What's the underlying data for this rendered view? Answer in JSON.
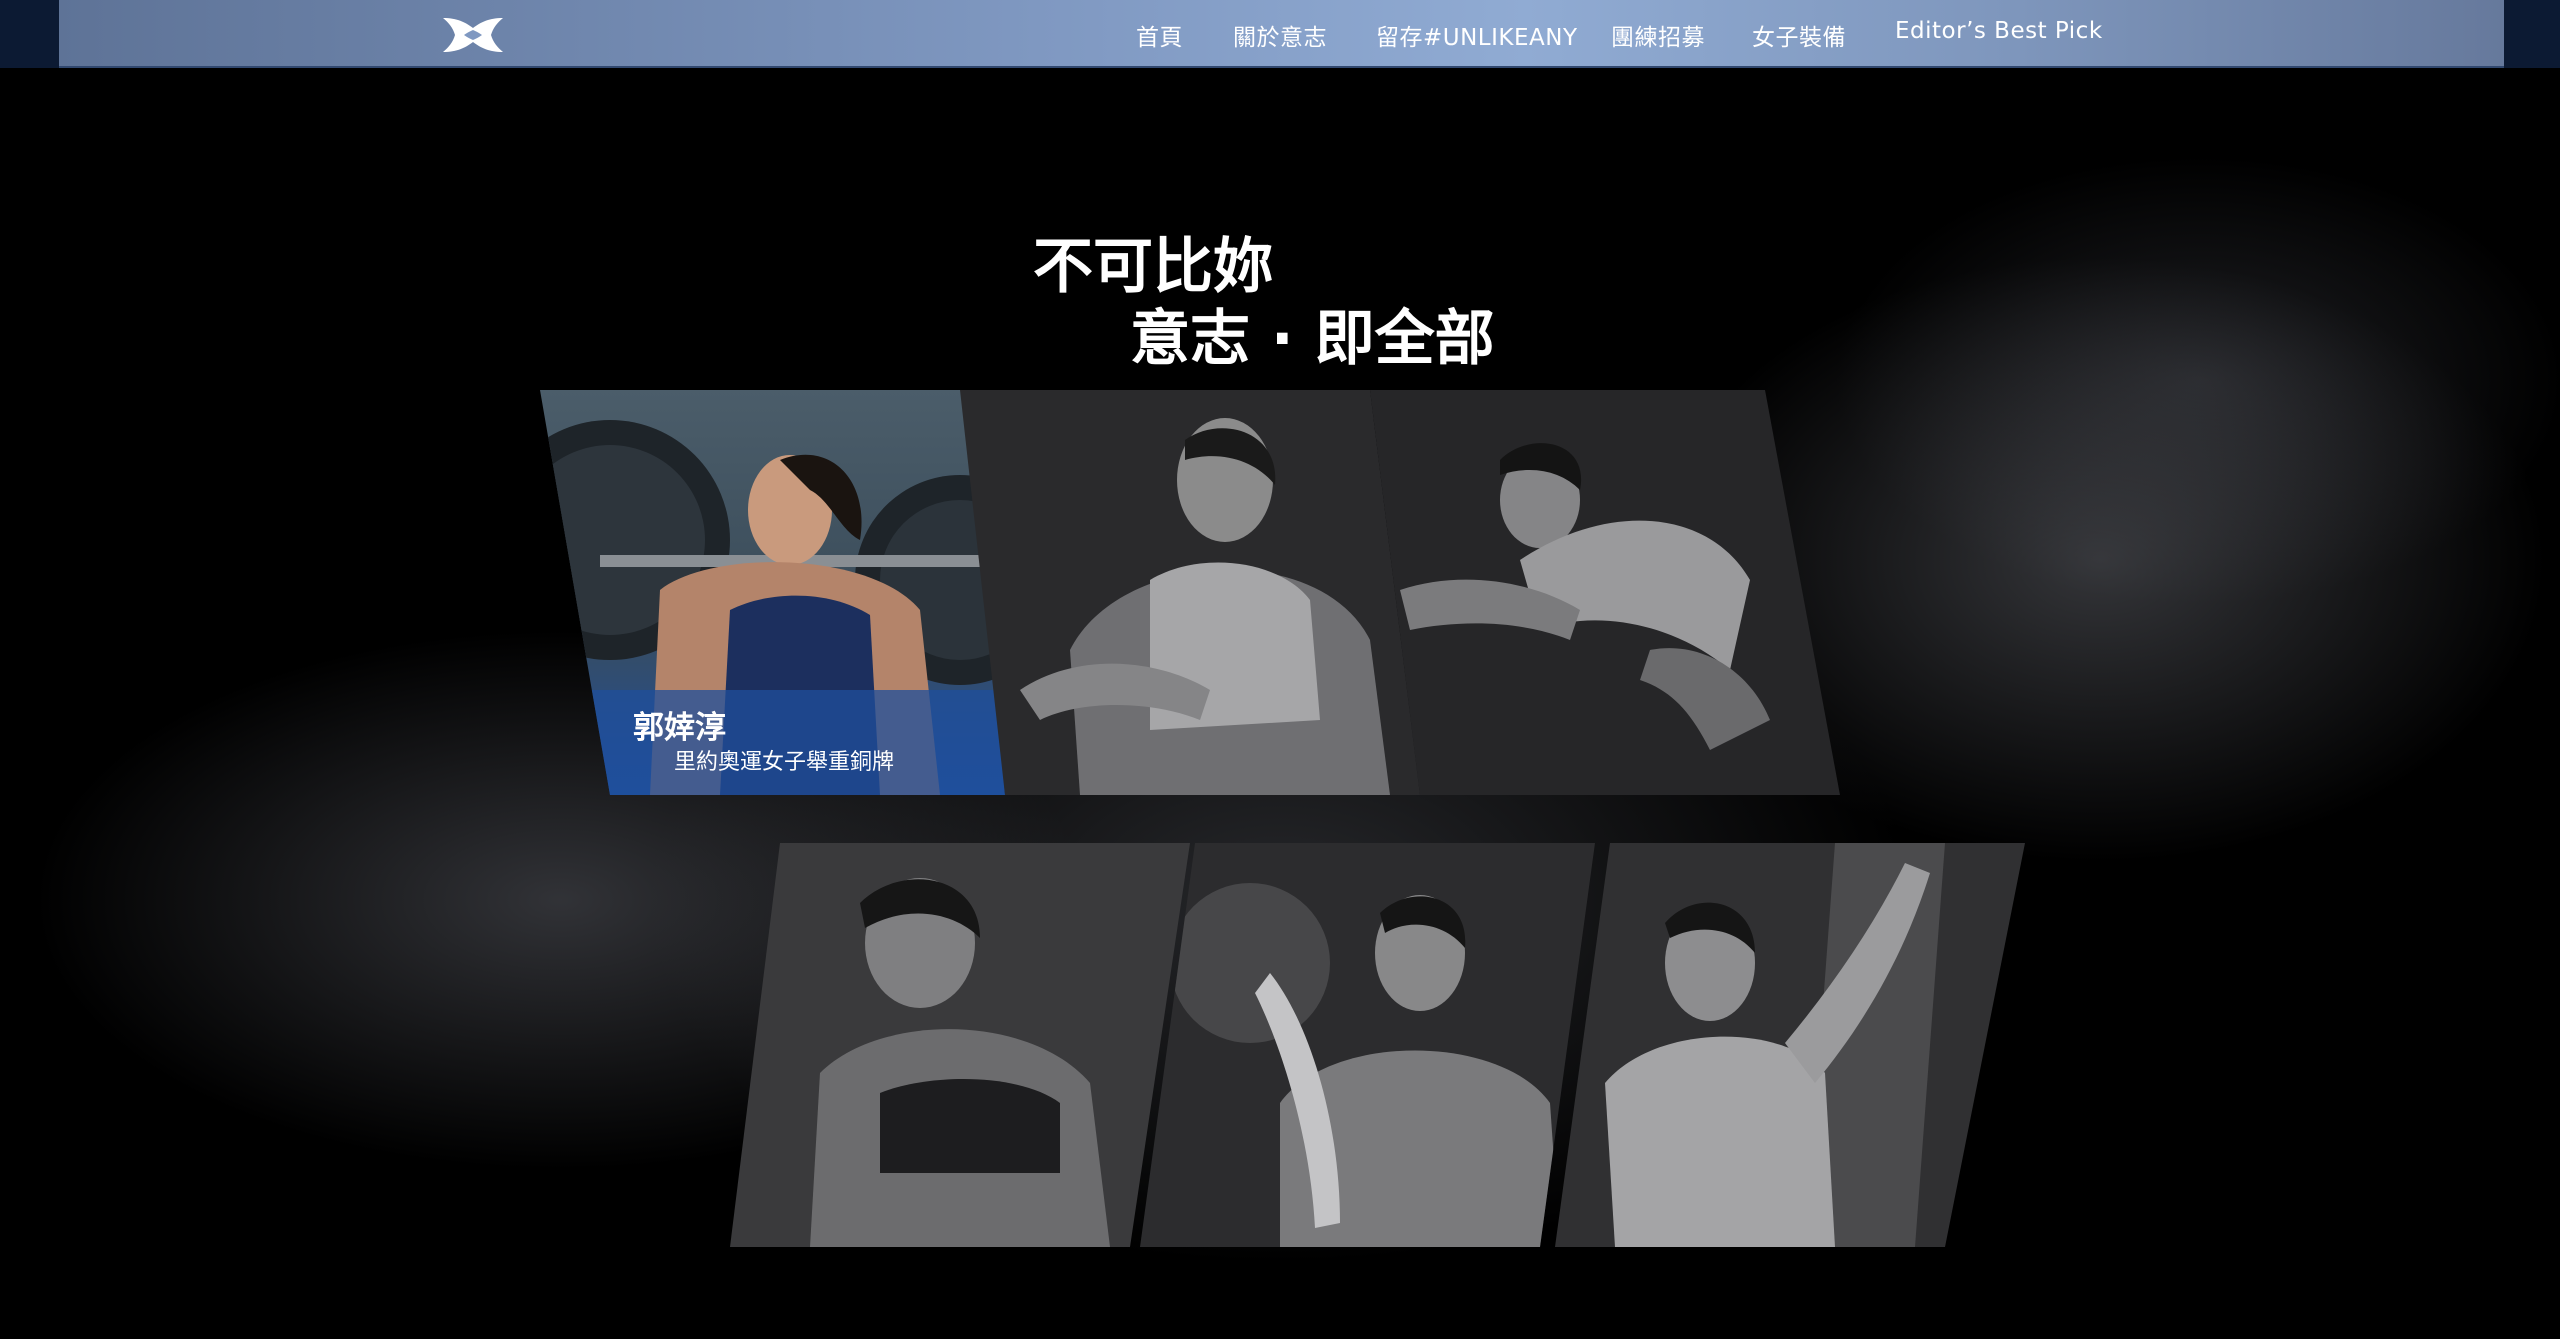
{
  "header": {
    "logo_name": "under-armour-logo",
    "nav": [
      {
        "label": "首頁"
      },
      {
        "label": "關於意志"
      },
      {
        "label": "留存#UNLIKEANY"
      },
      {
        "label": "團練招募"
      },
      {
        "label": "女子裝備"
      },
      {
        "label": "Editor’s Best Pick"
      }
    ]
  },
  "hero": {
    "headline_line1": "不可比妳",
    "headline_line2": "意志 · 即全部"
  },
  "athletes": [
    {
      "name": "郭婞淳",
      "title": "里約奧運女子舉重銅牌",
      "highlighted": true
    },
    {
      "name": "",
      "title": "",
      "highlighted": false
    },
    {
      "name": "",
      "title": "",
      "highlighted": false
    },
    {
      "name": "",
      "title": "",
      "highlighted": false
    },
    {
      "name": "",
      "title": "",
      "highlighted": false
    },
    {
      "name": "",
      "title": "",
      "highlighted": false
    }
  ],
  "colors": {
    "header_gradient_mid": "#90abd3",
    "header_border": "#31486f",
    "page_bg": "#000000",
    "highlight_blue": "#1f4f9c"
  }
}
